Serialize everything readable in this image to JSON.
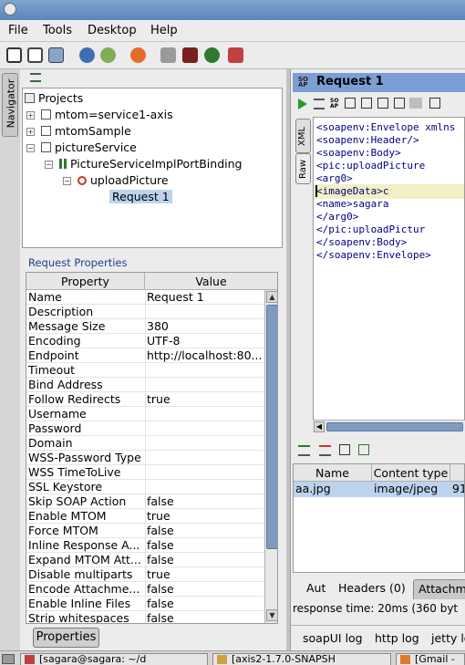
{
  "menu": {
    "file": "File",
    "tools": "Tools",
    "desktop": "Desktop",
    "help": "Help"
  },
  "navigator": {
    "tab_label": "Navigator"
  },
  "tree": {
    "root": "Projects",
    "items": [
      {
        "label": "mtom=service1-axis"
      },
      {
        "label": "mtomSample"
      },
      {
        "label": "pictureService"
      },
      {
        "label": "PictureServiceImplPortBinding"
      },
      {
        "label": "uploadPicture"
      },
      {
        "label": "Request 1"
      }
    ]
  },
  "properties": {
    "title": "Request Properties",
    "headers": {
      "property": "Property",
      "value": "Value"
    },
    "rows": [
      {
        "name": "Name",
        "value": "Request 1"
      },
      {
        "name": "Description",
        "value": ""
      },
      {
        "name": "Message Size",
        "value": "380"
      },
      {
        "name": "Encoding",
        "value": "UTF-8"
      },
      {
        "name": "Endpoint",
        "value": "http://localhost:80..."
      },
      {
        "name": "Timeout",
        "value": ""
      },
      {
        "name": "Bind Address",
        "value": ""
      },
      {
        "name": "Follow Redirects",
        "value": "true"
      },
      {
        "name": "Username",
        "value": ""
      },
      {
        "name": "Password",
        "value": ""
      },
      {
        "name": "Domain",
        "value": ""
      },
      {
        "name": "WSS-Password Type",
        "value": ""
      },
      {
        "name": "WSS TimeToLive",
        "value": ""
      },
      {
        "name": "SSL Keystore",
        "value": ""
      },
      {
        "name": "Skip SOAP Action",
        "value": "false"
      },
      {
        "name": "Enable MTOM",
        "value": "true"
      },
      {
        "name": "Force MTOM",
        "value": "false"
      },
      {
        "name": "Inline Response A...",
        "value": "false"
      },
      {
        "name": "Expand MTOM Att...",
        "value": "false"
      },
      {
        "name": "Disable multiparts",
        "value": "true"
      },
      {
        "name": "Encode Attachme...",
        "value": "false"
      },
      {
        "name": "Enable Inline Files",
        "value": "false"
      },
      {
        "name": "Strip whitespaces",
        "value": "false"
      }
    ],
    "button": "Properties"
  },
  "request": {
    "title": "Request 1",
    "vtab_xml": "XML",
    "vtab_raw": "Raw",
    "xml_lines": [
      "<soapenv:Envelope xmlns",
      "   <soapenv:Header/>",
      "   <soapenv:Body>",
      "      <pic:uploadPicture",
      "         <arg0>",
      "            <imageData>c",
      "            <name>sagara",
      "         </arg0>",
      "      </pic:uploadPictur",
      "   </soapenv:Body>",
      "</soapenv:Envelope>"
    ]
  },
  "attachments": {
    "headers": {
      "name": "Name",
      "content_type": "Content type",
      "size": ""
    },
    "rows": [
      {
        "name": "aa.jpg",
        "content_type": "image/jpeg",
        "size": "91"
      }
    ]
  },
  "bottom_tabs": {
    "auth": "Aut",
    "headers": "Headers (0)",
    "attachments": "Attachm"
  },
  "status": "response time: 20ms (360 byt",
  "log_tabs": {
    "soapui": "soapUI log",
    "http": "http log",
    "jetty": "jetty lo"
  },
  "taskbar": [
    {
      "label": "[sagara@sagara: ~/d"
    },
    {
      "label": "[axis2-1.7.0-SNAPSH"
    },
    {
      "label": "[Gmail -"
    }
  ],
  "colors": {
    "title_accent": "#7c9ed4",
    "selection": "#bcd3ee",
    "xml_tag": "#000080",
    "highlight_line": "#f2f0c4"
  }
}
